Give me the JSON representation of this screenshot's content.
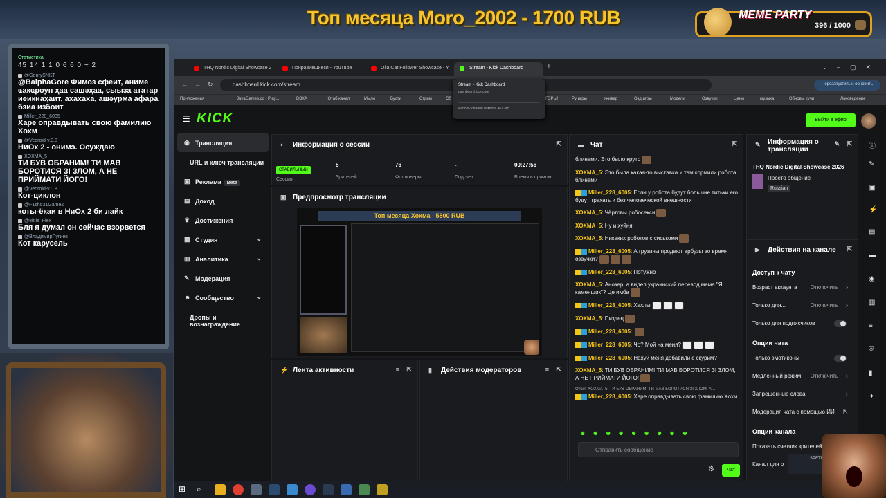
{
  "overlay": {
    "banner_title": "Топ месяца Moro_2002 - 1700 RUB",
    "meme_title": "MEME PARTY",
    "meme_count": "396 / 1000"
  },
  "side_chat": {
    "stats_title": "Статистика",
    "stats": "45 14 1 1 0 6 6 0 ~ 2",
    "messages": [
      {
        "user": "@GenrySNKT",
        "text": "@BalphaGore Фимоз сфеит, аниме ҩакҩроуп ҳаа сашәҳаа, сыыза ататар иеикнаҳаит, ахахаха, ашәурма афара бзиа избоит"
      },
      {
        "user": "Miller_228_6005",
        "text": "Харе оправдывать свою фамилию Хохм"
      },
      {
        "user": "@Vedroid-v.0.8",
        "text": "НиОх 2 - онимэ. Осуждаю"
      },
      {
        "user": "XOXMA_5",
        "text": "ТИ БУВ ОБРАНИМ! ТИ МАВ БОРОТИСЯ ЗІ ЗЛОМ, А НЕ ПРИЙМАТИ ЙОГО!"
      },
      {
        "user": "@Vedroid-v.0.8",
        "text": "Кот-циклон"
      },
      {
        "user": "@F1sh531GameZ",
        "text": "коты-ёкаи в НиОх 2 би лайк"
      },
      {
        "user": "@8ittle_Flex",
        "text": "Бля я думал он сейчас взорвется"
      },
      {
        "user": "@ВладимирПугиев",
        "text": "Кот карусель"
      }
    ]
  },
  "browser": {
    "tabs": [
      {
        "label": "THQ Nordic Digital Showcase 2"
      },
      {
        "label": "Понравившиеся - YouTube"
      },
      {
        "label": "Olia Cat Follower Showcase - Y"
      },
      {
        "label": "Stream - Kick Dashboard"
      }
    ],
    "url": "dashboard.kick.com/stream",
    "relaunch": "Перезапустить и обновить",
    "bookmarks": [
      "Приложения",
      "JavaGames.cc - Play...",
      "ВЭКА",
      "Ютаб канал",
      "Мыло",
      "Бусти",
      "Стрим",
      "Сб",
      "ГОРЫ!",
      "Ру игры",
      "Универ",
      "Озд игры",
      "Модели",
      "Озвучки",
      "Цены",
      "музыка",
      "Обновы кучи",
      "Локоведение"
    ],
    "hover_card": {
      "title": "Stream - Kick Dashboard",
      "url": "dashboard.kick.com",
      "memory": "Использование памяти: 461 МБ"
    }
  },
  "kick": {
    "logo": "KICK",
    "go_live": "Выйти в эфир",
    "nav": [
      {
        "label": "Трансляция"
      },
      {
        "label": "URL и ключ трансляции"
      },
      {
        "label": "Реклама",
        "badge": "Beta"
      },
      {
        "label": "Доход"
      },
      {
        "label": "Достижения"
      },
      {
        "label": "Студия"
      },
      {
        "label": "Аналитика"
      },
      {
        "label": "Модерация"
      },
      {
        "label": "Сообщество"
      },
      {
        "label": "Дропы и вознаграждение"
      }
    ],
    "session": {
      "title": "Информация о сессии",
      "status": "СТАБИЛЬНЫЙ",
      "status_label": "Сессия",
      "viewers": "5",
      "viewers_label": "Зрителей",
      "followers": "76",
      "followers_label": "Фолловеры",
      "subs": "-",
      "subs_label": "Подсчет",
      "time": "00:27:56",
      "time_label": "Время в прямом"
    },
    "preview": {
      "title": "Предпросмотр трансляции",
      "banner": "Топ месяца Хохма - 5800 RUB"
    },
    "activity_title": "Лента активности",
    "mod_actions_title": "Действия модераторов",
    "chat": {
      "title": "Чат",
      "messages": [
        {
          "user": "",
          "text": "блинами. Это было круто",
          "color": "#ffffff"
        },
        {
          "user": "XOXMA_5",
          "text": "Это была какая-то выставка и там кормили робота блинами",
          "color": "#f5c518"
        },
        {
          "user": "Miller_228_6005",
          "text": "Если у робота будут большие титьки его будут трахать и без человеческой внешности",
          "color": "#f5c518"
        },
        {
          "user": "XOXMA_5",
          "text": "Чёртовы робосекси",
          "color": "#f5c518"
        },
        {
          "user": "XOXMA_5",
          "text": "Ну и хуйня",
          "color": "#f5c518"
        },
        {
          "user": "XOXMA_5",
          "text": "Никаких роботов с сиськоми",
          "color": "#f5c518"
        },
        {
          "user": "Miller_228_6005",
          "text": "А грузины продают арбузы во время озвучки?",
          "color": "#f5c518"
        },
        {
          "user": "Miller_228_6005",
          "text": "Потужно",
          "color": "#f5c518"
        },
        {
          "user": "XOXMA_5",
          "text": "Анозер, а видел украинский перевод мема \"Я каменщик\"? Це имба",
          "color": "#f5c518"
        },
        {
          "user": "Miller_228_6005",
          "text": "Хахлы",
          "color": "#f5c518"
        },
        {
          "user": "XOXMA_5",
          "text": "Пиздец",
          "color": "#f5c518"
        },
        {
          "user": "Miller_228_6005",
          "text": "",
          "color": "#f5c518"
        },
        {
          "user": "Miller_228_6005",
          "text": "Чо? Мой на меня?",
          "color": "#f5c518"
        },
        {
          "user": "Miller_228_6005",
          "text": "Нахуй меня добавили с скурим?",
          "color": "#f5c518"
        },
        {
          "user": "XOXMA_5",
          "text": "ТИ БУВ ОБРАНИМ! ТИ МАВ БОРОТИСЯ ЗІ ЗЛОМ, А НЕ ПРИЙМАТИ ЙОГО!",
          "color": "#f5c518"
        },
        {
          "user": "Miller_228_6005",
          "text": "Харе оправдывать свою фамилию Хохм",
          "color": "#f5c518"
        }
      ],
      "reply_to": "Ответ XOXMA_5: ТИ БУВ ОБРАНИМ! ТИ МАВ БОРОТИСЯ ЗІ ЗЛОМ, А...",
      "input_placeholder": "Отправить сообщение",
      "send": "Чат"
    },
    "stream_info": {
      "title": "Информация о трансляции",
      "stream_title": "THQ Nordic Digital Showcase 2026",
      "category": "Просто общение",
      "tag": "Russian"
    },
    "channel_actions": {
      "title": "Действия на канале",
      "access_title": "Доступ к чату",
      "account_age": "Возраст аккаунта",
      "account_age_val": "Отключить",
      "only_for": "Только для...",
      "only_for_val": "Отключить",
      "subs_only": "Только для подписчиков",
      "chat_options": "Опции чата",
      "emotes_only": "Только эмотиконы",
      "slow_mode": "Медленный режим",
      "slow_mode_val": "Отключить",
      "banned_words": "Запрещенные слова",
      "ai_mod": "Модерация чата с помощью ИИ",
      "channel_options": "Опции канала",
      "show_counter": "Показать счетчик зрителей",
      "channel_for": "Канал для р"
    }
  },
  "mini_notif": "SPETN"
}
